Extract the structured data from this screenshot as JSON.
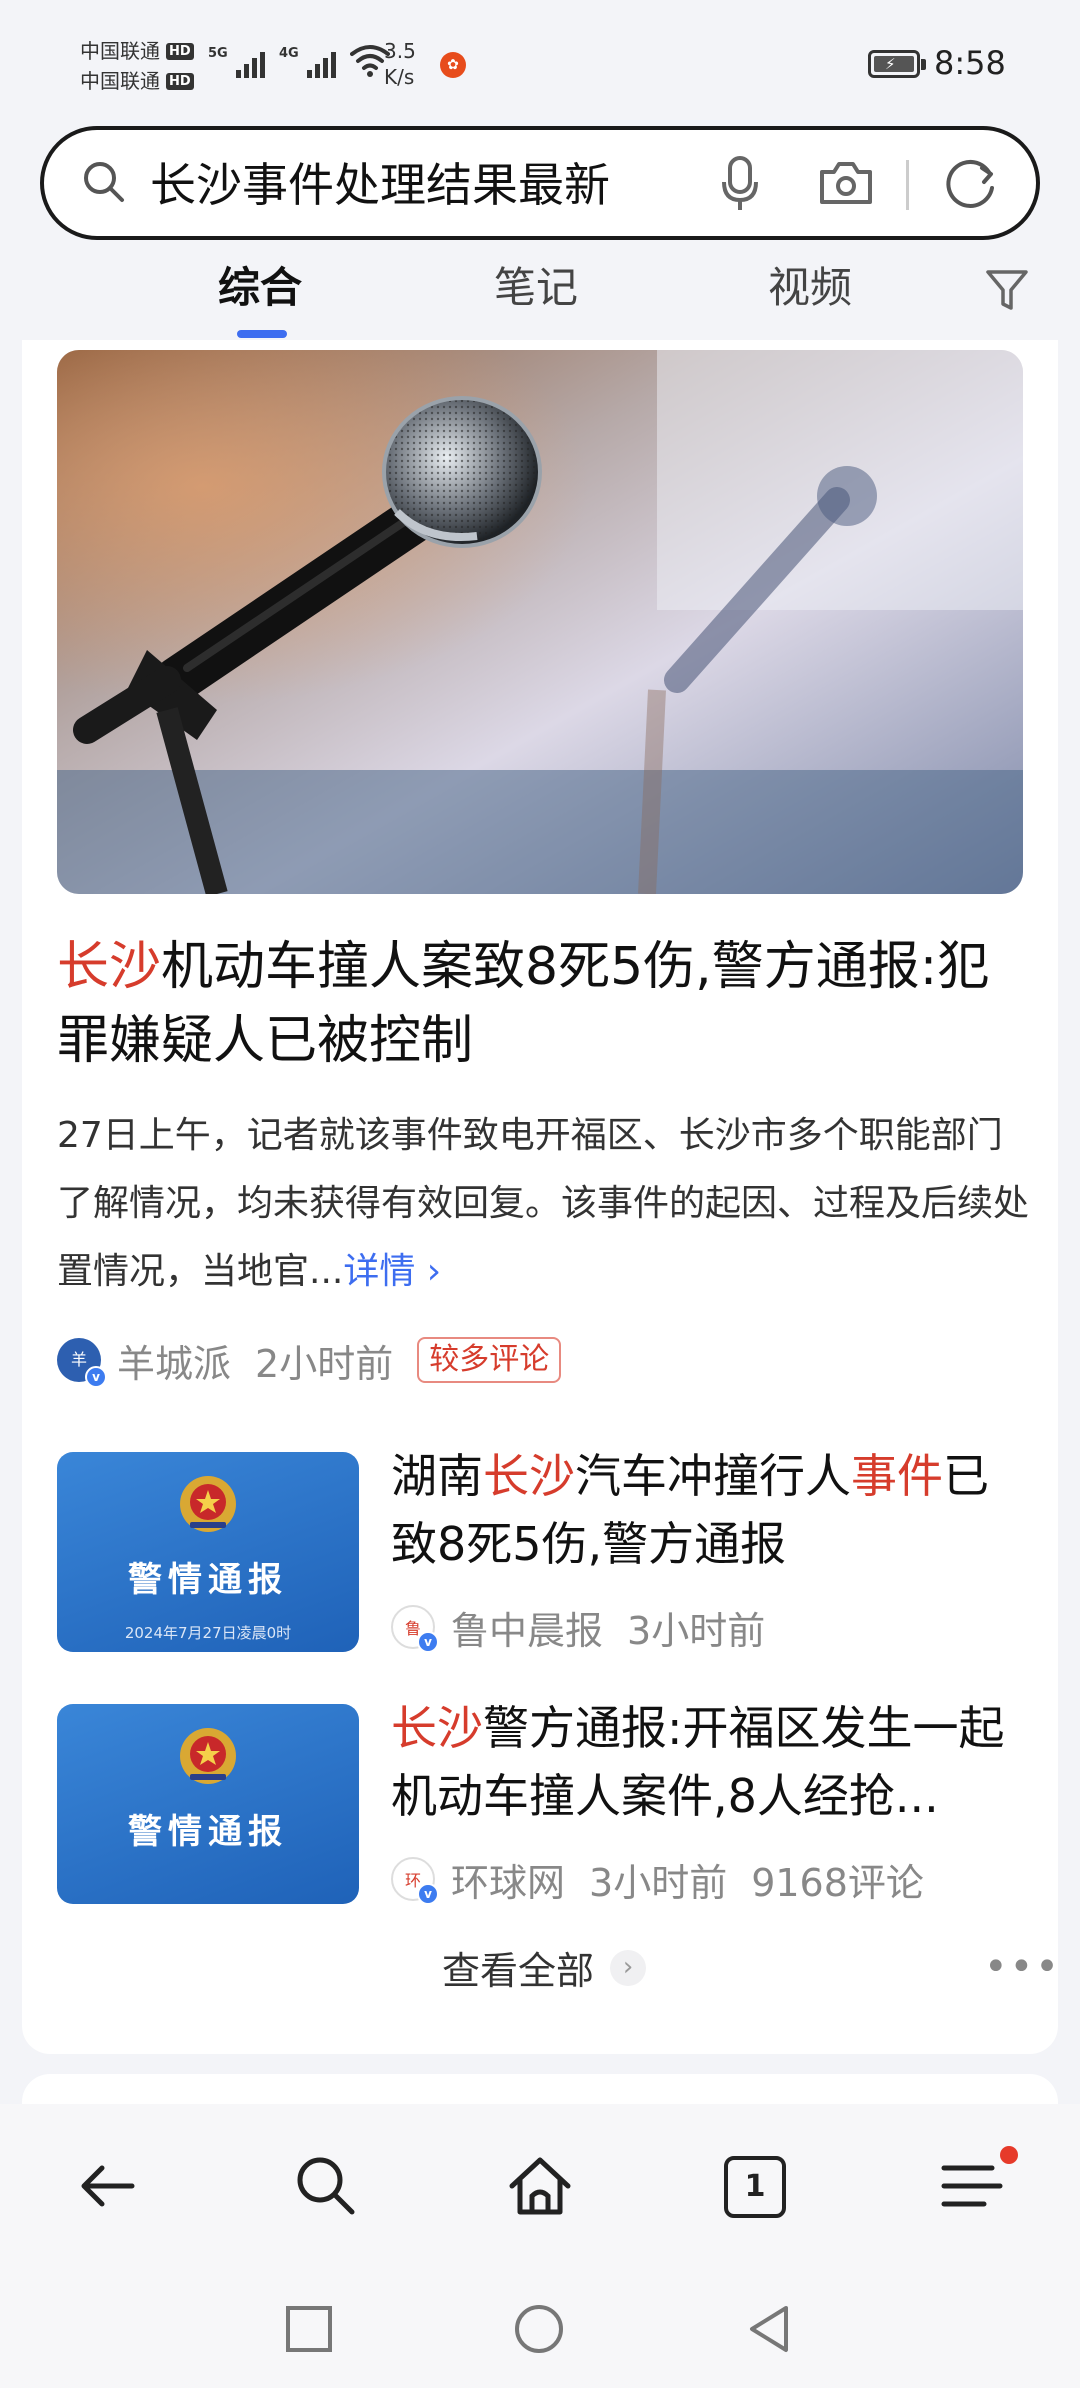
{
  "status_bar": {
    "carrier_1": "中国联通",
    "carrier_2": "中国联通",
    "hd": "HD",
    "sig1_tag": "5G",
    "sig2_tag": "4G",
    "speed_value": "3.5",
    "speed_unit": "K/s",
    "time": "8:58"
  },
  "search": {
    "query": "长沙事件处理结果最新"
  },
  "tabs": [
    {
      "label": "综合",
      "active": true
    },
    {
      "label": "笔记",
      "active": false
    },
    {
      "label": "视频",
      "active": false
    }
  ],
  "top_result": {
    "title_highlight": "长沙",
    "title_rest": "机动车撞人案致8死5伤,警方通报:犯罪嫌疑人已被控制",
    "snippet": "27日上午，记者就该事件致电开福区、长沙市多个职能部门了解情况，均未获得有效回复。该事件的起因、过程及后续处置情况，当地官...",
    "detail_link": "详情",
    "source": "羊城派",
    "time": "2小时前",
    "tag": "较多评论"
  },
  "news_items": [
    {
      "title_parts": [
        "湖南",
        "长沙",
        "汽车冲撞行人",
        "事件",
        "已致8死5伤,警方通报"
      ],
      "source": "鲁中晨报",
      "time": "3小时前",
      "thumb_title": "警情通报",
      "thumb_date": "2024年7月27日凌晨0时"
    },
    {
      "title_parts": [
        "长沙",
        "警方通报:开福区发生一起机动车撞人案件,8人经抢..."
      ],
      "source": "环球网",
      "time": "3小时前",
      "comments": "9168评论",
      "thumb_title": "警情通报"
    }
  ],
  "see_all": "查看全部",
  "more": "•••",
  "bottom_nav": {
    "tab_count": "1"
  },
  "colors": {
    "highlight": "#d63c2c",
    "accent": "#3d6df0"
  }
}
